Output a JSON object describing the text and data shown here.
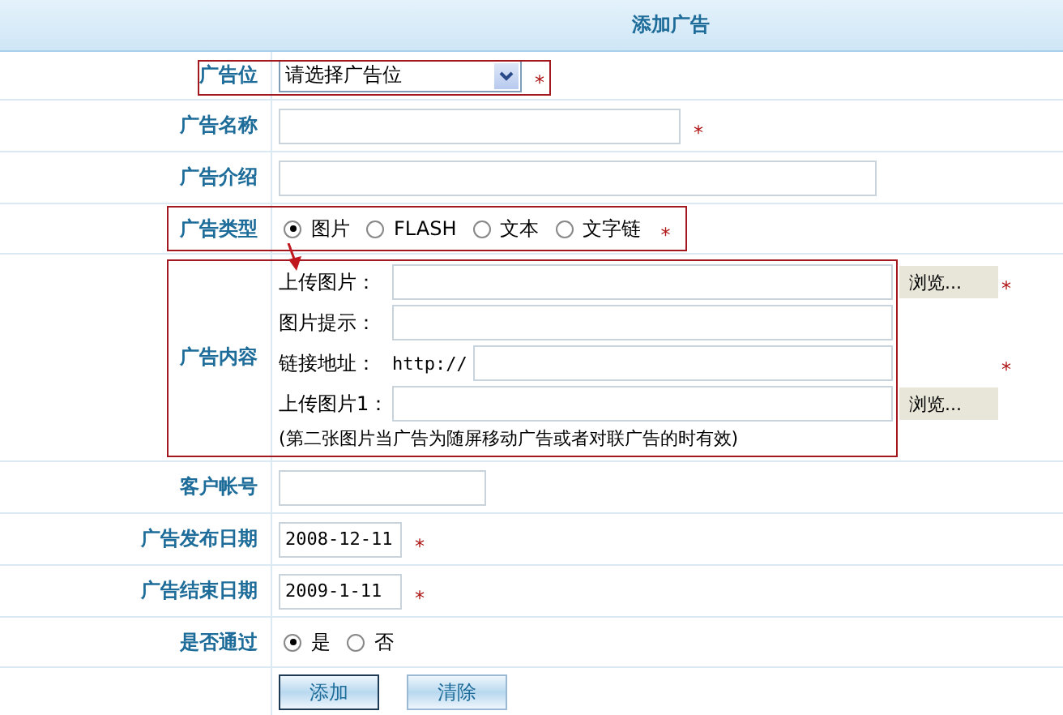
{
  "title": "添加广告",
  "rows": [
    {
      "kind": "select",
      "label": "广告位",
      "value": "请选择广告位",
      "mark": "*",
      "highlighted": true
    },
    {
      "kind": "text",
      "label": "广告名称",
      "mark": "*"
    },
    {
      "kind": "text",
      "label": "广告介绍"
    },
    {
      "kind": "radios",
      "label": "广告类型",
      "mark": "*",
      "highlighted": true,
      "options": [
        {
          "label": "图片",
          "selected": true
        },
        {
          "label": "FLASH",
          "selected": false
        },
        {
          "label": "文本",
          "selected": false
        },
        {
          "label": "文字链",
          "selected": false
        }
      ]
    },
    {
      "kind": "content",
      "label": "广告内容",
      "highlighted": true,
      "fields": [
        {
          "label": "上传图片：",
          "browse": "浏览...",
          "mark": "*"
        },
        {
          "label": "图片提示："
        },
        {
          "label": "链接地址：",
          "prefix": "http://",
          "mark": "*"
        },
        {
          "label": "上传图片1：",
          "browse": "浏览..."
        }
      ],
      "note": "(第二张图片当广告为随屏移动广告或者对联广告的时有效)"
    },
    {
      "kind": "text",
      "label": "客户帐号"
    },
    {
      "kind": "date",
      "label": "广告发布日期",
      "value": "2008-12-11",
      "mark": "*"
    },
    {
      "kind": "date",
      "label": "广告结束日期",
      "value": "2009-1-11",
      "mark": "*"
    },
    {
      "kind": "radios",
      "label": "是否通过",
      "options": [
        {
          "label": "是",
          "selected": true
        },
        {
          "label": "否",
          "selected": false
        }
      ]
    },
    {
      "kind": "buttons",
      "buttons": [
        "添加",
        "清除"
      ]
    }
  ],
  "arrow": true
}
